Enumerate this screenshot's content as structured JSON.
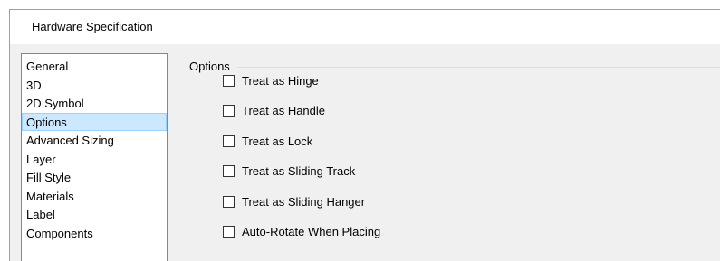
{
  "window": {
    "title": "Hardware Specification"
  },
  "sidebar": {
    "items": [
      {
        "label": "General",
        "selected": false
      },
      {
        "label": "3D",
        "selected": false
      },
      {
        "label": "2D Symbol",
        "selected": false
      },
      {
        "label": "Options",
        "selected": true
      },
      {
        "label": "Advanced Sizing",
        "selected": false
      },
      {
        "label": "Layer",
        "selected": false
      },
      {
        "label": "Fill Style",
        "selected": false
      },
      {
        "label": "Materials",
        "selected": false
      },
      {
        "label": "Label",
        "selected": false
      },
      {
        "label": "Components",
        "selected": false
      }
    ]
  },
  "options": {
    "group_label": "Options",
    "checkboxes": [
      {
        "label": "Treat as Hinge",
        "checked": false
      },
      {
        "label": "Treat as Handle",
        "checked": false
      },
      {
        "label": "Treat as Lock",
        "checked": false
      },
      {
        "label": "Treat as Sliding Track",
        "checked": false
      },
      {
        "label": "Treat as Sliding Hanger",
        "checked": false
      },
      {
        "label": "Auto-Rotate When Placing",
        "checked": false
      }
    ]
  },
  "colors": {
    "selection_bg": "#cce8ff",
    "selection_border": "#99d1ff",
    "dialog_bg": "#f0f0f0"
  }
}
